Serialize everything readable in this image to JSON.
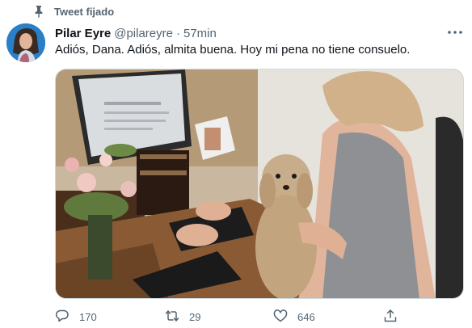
{
  "pinned": {
    "label": "Tweet fijado",
    "icon": "pin-icon"
  },
  "author": {
    "display_name": "Pilar Eyre",
    "handle": "@pilareyre",
    "separator": "·",
    "time": "57min"
  },
  "tweet": {
    "text": "Adiós, Dana. Adiós, almita buena. Hoy mi pena no tiene consuelo."
  },
  "actions": {
    "reply_count": "170",
    "retweet_count": "29",
    "like_count": "646"
  },
  "colors": {
    "secondary_text": "#536471",
    "primary_text": "#0f1419",
    "border": "#cfd9de"
  }
}
